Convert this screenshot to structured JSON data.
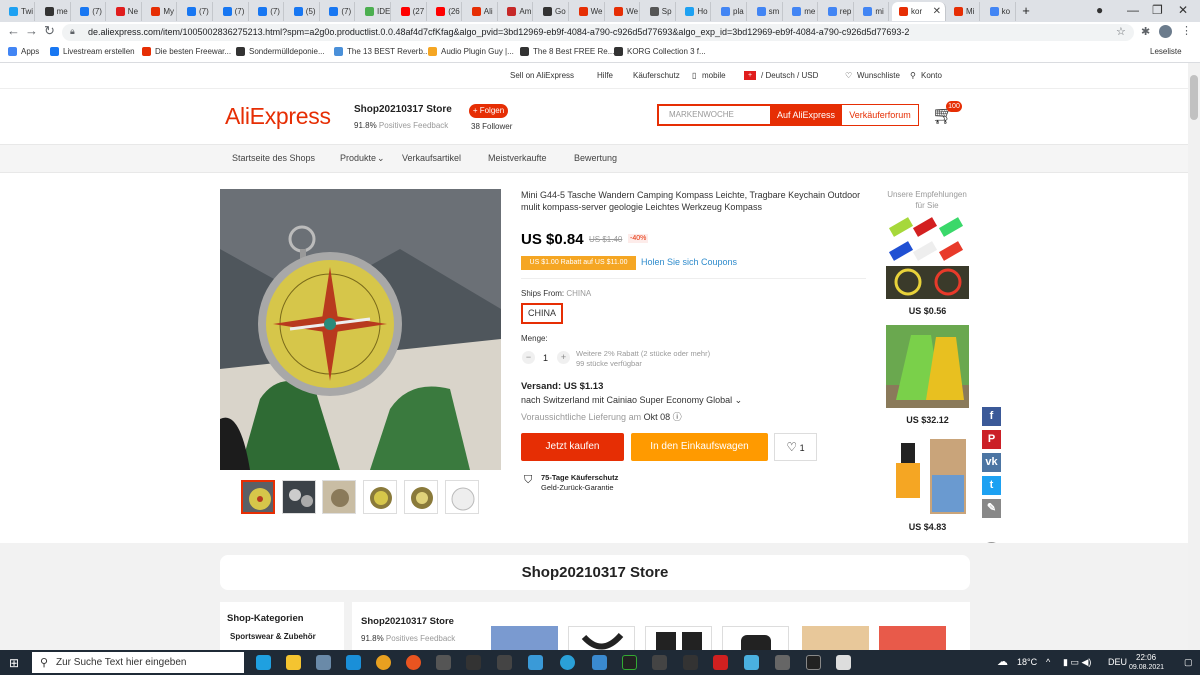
{
  "browser": {
    "tabs": [
      {
        "label": "Twi",
        "color": "#1da1f2"
      },
      {
        "label": "me",
        "color": "#333333"
      },
      {
        "label": "(7)",
        "color": "#1877f2"
      },
      {
        "label": "Ne",
        "color": "#e01d1d"
      },
      {
        "label": "My",
        "color": "#e62e04"
      },
      {
        "label": "(7)",
        "color": "#1877f2"
      },
      {
        "label": "(7)",
        "color": "#1877f2"
      },
      {
        "label": "(7)",
        "color": "#1877f2"
      },
      {
        "label": "(5)",
        "color": "#1877f2"
      },
      {
        "label": "(7)",
        "color": "#1877f2"
      },
      {
        "label": "IDE",
        "color": "#4caf50"
      },
      {
        "label": "(27",
        "color": "#ff0000"
      },
      {
        "label": "(26",
        "color": "#ff0000"
      },
      {
        "label": "Ali",
        "color": "#e62e04"
      },
      {
        "label": "Am",
        "color": "#c62828"
      },
      {
        "label": "Go",
        "color": "#333333"
      },
      {
        "label": "We",
        "color": "#e62e04"
      },
      {
        "label": "We",
        "color": "#e62e04"
      },
      {
        "label": "Sp",
        "color": "#555555"
      },
      {
        "label": "Ho",
        "color": "#1da1f2"
      },
      {
        "label": "pla",
        "color": "#4285f4"
      },
      {
        "label": "sm",
        "color": "#4285f4"
      },
      {
        "label": "me",
        "color": "#4285f4"
      },
      {
        "label": "rep",
        "color": "#4285f4"
      },
      {
        "label": "mi",
        "color": "#4285f4"
      },
      {
        "label": "kor",
        "color": "#e62e04",
        "active": true
      },
      {
        "label": "Mi",
        "color": "#e62e04"
      },
      {
        "label": "ko",
        "color": "#4285f4"
      }
    ],
    "new_tab": "+",
    "url": "de.aliexpress.com/item/1005002836275213.html?spm=a2g0o.productlist.0.0.48af4d7cfKfag&algo_pvid=3bd12969-eb9f-4084-a790-c926d5d77693&algo_exp_id=3bd12969-eb9f-4084-a790-c926d5d77693-2",
    "bookmarks": [
      {
        "label": "Apps",
        "color": "#4285f4"
      },
      {
        "label": "Livestream erstellen",
        "color": "#1877f2"
      },
      {
        "label": "Die besten Freewar...",
        "color": "#e62e04"
      },
      {
        "label": "Sondermülldeponie...",
        "color": "#333333"
      },
      {
        "label": "The 13 BEST Reverb...",
        "color": "#4a90d9"
      },
      {
        "label": "Audio Plugin Guy |...",
        "color": "#f5a623"
      },
      {
        "label": "The 8 Best FREE Re...",
        "color": "#333333"
      },
      {
        "label": "KORG Collection 3 f...",
        "color": "#333333"
      }
    ],
    "reading_list": "Leseliste"
  },
  "topnav": {
    "sell": "Sell on AliExpress",
    "help": "Hilfe",
    "protection": "Käuferschutz",
    "mobile": "mobile",
    "locale": "/ Deutsch / USD",
    "wishlist": "Wunschliste",
    "account": "Konto"
  },
  "header": {
    "logo": "AliExpress",
    "store_name": "Shop20210317 Store",
    "feedback_pct": "91.8%",
    "feedback_label": "Positives Feedback",
    "follow": "+ Folgen",
    "followers": "38 Follower",
    "search_placeholder": "MARKENWOCHE",
    "search_btn": "Auf AliExpress",
    "seller_forum": "Verkäuferforum",
    "cart_count": "100"
  },
  "storenav": {
    "home": "Startseite des Shops",
    "products": "Produkte",
    "sale": "Verkaufsartikel",
    "bestsellers": "Meistverkaufte",
    "reviews": "Bewertung"
  },
  "product": {
    "title": "Mini G44-5 Tasche Wandern Camping Kompass Leichte, Tragbare Keychain Outdoor mulit kompass-server geologie Leichtes Werkzeug Kompass",
    "price": "US $0.84",
    "old_price": "US $1.40",
    "discount": "-40%",
    "coupon": "US $1.00 Rabatt auf US $11.00",
    "coupon_link": "Holen Sie sich Coupons",
    "ships_from_label": "Ships From:",
    "ships_from_value": "CHINA",
    "ships_option": "CHINA",
    "qty_label": "Menge:",
    "qty_minus": "−",
    "qty": "1",
    "qty_plus": "+",
    "qty_info1": "Weitere 2% Rabatt (2 stücke oder mehr)",
    "qty_info2": "99 stücke verfügbar",
    "shipping": "Versand: US $1.13",
    "shipping_to": "nach Switzerland mit Cainiao Super Economy Global",
    "delivery_label": "Voraussichtliche Lieferung am",
    "delivery_date": "Okt 08",
    "buy": "Jetzt kaufen",
    "add_cart": "In den Einkaufswagen",
    "wish_count": "1",
    "protect_title": "75-Tage Käuferschutz",
    "protect_sub": "Geld-Zurück-Garantie"
  },
  "recommend": {
    "title": "Unsere Empfehlungen für Sie",
    "items": [
      {
        "price": "US $0.56"
      },
      {
        "price": "US $32.12"
      },
      {
        "price": "US $4.83"
      }
    ]
  },
  "social": [
    {
      "icon": "facebook-icon",
      "glyph": "f",
      "color": "#3b5998"
    },
    {
      "icon": "pinterest-icon",
      "glyph": "P",
      "color": "#cb2027"
    },
    {
      "icon": "vk-icon",
      "glyph": "vk",
      "color": "#4c75a3"
    },
    {
      "icon": "twitter-icon",
      "glyph": "t",
      "color": "#1da1f2"
    },
    {
      "icon": "edit-icon",
      "glyph": "✎",
      "color": "#888888"
    }
  ],
  "lower": {
    "store_banner": "Shop20210317 Store",
    "cat_title": "Shop-Kategorien",
    "cat_item": "Sportswear & Zubehör",
    "store_name": "Shop20210317 Store",
    "feedback_pct": "91.8%",
    "feedback_label": "Positives Feedback"
  },
  "taskbar": {
    "search": "Zur Suche Text hier eingeben",
    "temp": "18°C",
    "lang": "DEU",
    "time": "22:06",
    "date": "09.08.2021"
  }
}
